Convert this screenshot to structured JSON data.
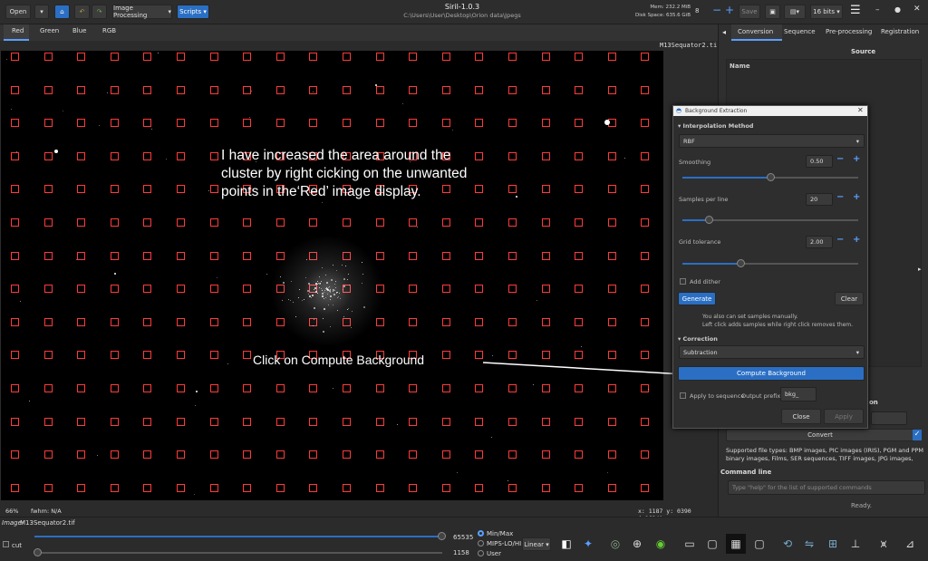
{
  "window": {
    "title": "Siril-1.0.3",
    "path": "C:\\Users\\User\\Desktop\\Orion data\\Jpegs",
    "mem": "Mem: 232.2 MiB",
    "disk": "Disk Space: 635.6 GiB",
    "threads": "8"
  },
  "toolbar": {
    "open": "Open",
    "image_processing": "Image Processing",
    "scripts": "Scripts",
    "save": "Save",
    "bits": "16 bits"
  },
  "channels": [
    "Red",
    "Green",
    "Blue",
    "RGB"
  ],
  "filename": "M13Sequator2.tif",
  "annotation_1": "I have increased the area around the cluster by right cicking on the unwanted points in the‘Red’ image display.",
  "annotation_2": "Click on Compute Background",
  "status": {
    "zoom": "66%",
    "fwhm": "fwhm: N/A",
    "coords": "x: 1187  y: 0390 (=1624)"
  },
  "bottom": {
    "image_label": "Image:",
    "image_name": "M13Sequator2.tif",
    "cut": "cut",
    "max_value": "65535",
    "min_value": "1158",
    "modes": [
      "Min/Max",
      "MIPS-LO/HI",
      "User"
    ],
    "scale": "Linear"
  },
  "right_panel": {
    "tabs": [
      "Conversion",
      "Sequence",
      "Pre-processing",
      "Registration"
    ],
    "source": "Source",
    "name_col": "Name",
    "on_label": "on",
    "convert": "Convert",
    "supported_label": "Supported file types:",
    "supported_text": "BMP images, PIC images (IRIS), PGM and PPM binary images, Films, SER sequences, TIFF images, JPG images,",
    "command_line": "Command line",
    "command_placeholder": "Type \"help\" for the list of supported commands",
    "ready": "Ready."
  },
  "dialog": {
    "title": "Background Extraction",
    "interp_header": "Interpolation Method",
    "interp_value": "RBF",
    "smoothing_label": "Smoothing",
    "smoothing_value": "0.50",
    "smoothing_level": 0.5,
    "samples_label": "Samples per line",
    "samples_value": "20",
    "samples_level": 0.15,
    "grid_label": "Grid tolerance",
    "grid_value": "2.00",
    "grid_level": 0.33,
    "add_dither": "Add dither",
    "generate": "Generate",
    "clear": "Clear",
    "hint1": "You also can set samples manually.",
    "hint2": "Left click adds samples while right click removes them.",
    "correction_header": "Correction",
    "correction_value": "Subtraction",
    "compute": "Compute Background",
    "apply_seq": "Apply to sequence",
    "output_prefix": "Output prefix:",
    "prefix_value": "bkg_",
    "close": "Close",
    "apply": "Apply"
  }
}
